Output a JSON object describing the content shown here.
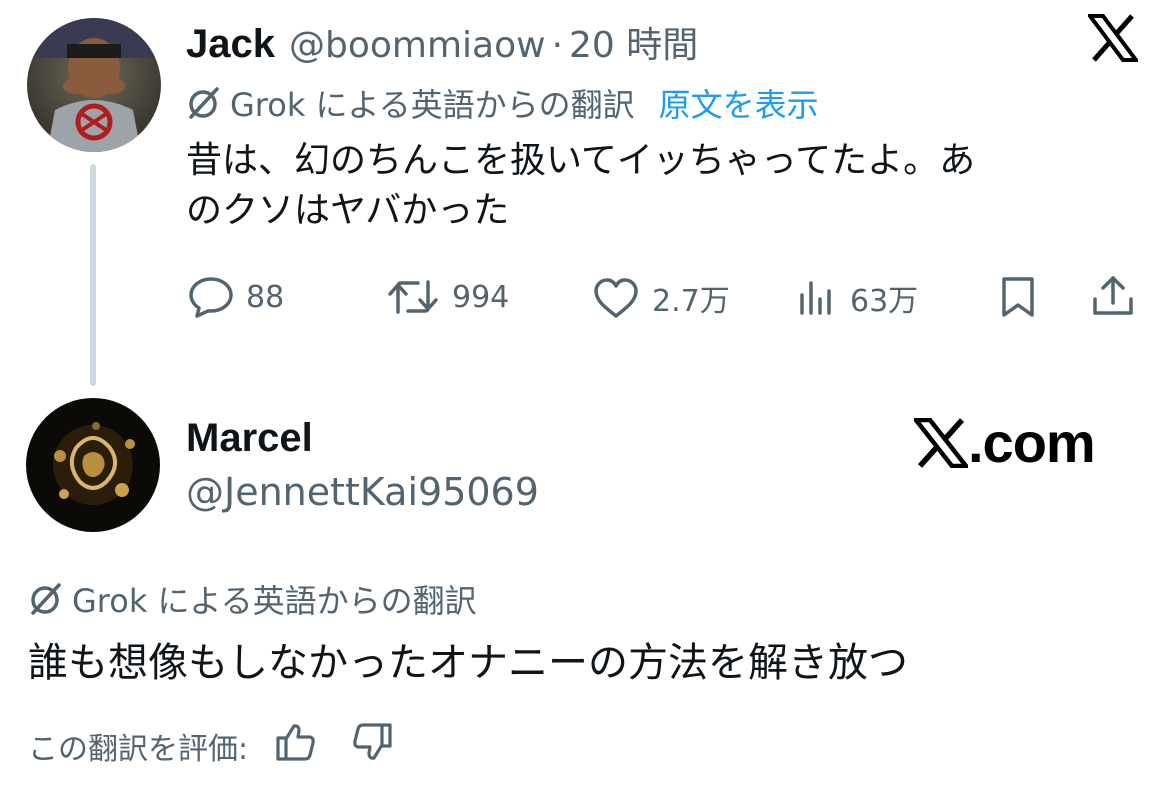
{
  "tweet": {
    "author_name": "Jack",
    "handle": "@boommiaow",
    "separator": "·",
    "time": "20 時間",
    "translation_label": "Grok による英語からの翻訳",
    "show_original": "原文を表示",
    "text_line1": "昔は、幻のちんこを扱いてイッちゃってたよ。あ",
    "text_line2": "のクソはヤバかった",
    "actions": {
      "replies": "88",
      "reposts": "994",
      "likes": "2.7万",
      "views": "63万"
    }
  },
  "reply": {
    "author_name": "Marcel",
    "handle": "@JennettKai95069",
    "translation_label": "Grok による英語からの翻訳",
    "text": "誰も想像もしなかったオナニーの方法を解き放つ",
    "rate_label": "この翻訳を評価:"
  },
  "brand": {
    "x_logo_name": "x-logo-icon",
    "xcom_text": ".com"
  },
  "colors": {
    "text": "#0f1419",
    "secondary": "#536471",
    "link": "#1d9bf0",
    "thread_line": "#cfd9de"
  }
}
